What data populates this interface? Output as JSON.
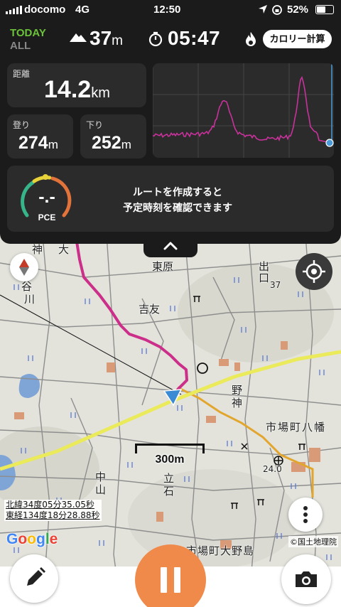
{
  "status_bar": {
    "carrier": "docomo",
    "network": "4G",
    "time": "12:50",
    "battery": "52%",
    "battery_level": 0.52
  },
  "header": {
    "today_label": "TODAY",
    "all_label": "ALL",
    "altitude_value": "37",
    "altitude_unit": "m",
    "elapsed_time": "05:47",
    "calorie_button": "カロリー計算"
  },
  "stats": {
    "distance_label": "距離",
    "distance_value": "14.2",
    "distance_unit": "km",
    "ascent_label": "登り",
    "ascent_value": "274",
    "ascent_unit": "m",
    "descent_label": "下り",
    "descent_value": "252",
    "descent_unit": "m"
  },
  "pace": {
    "value": "-.-",
    "label": "PCE",
    "message_line1": "ルートを作成すると",
    "message_line2": "予定時刻を確認できます"
  },
  "elevation_chart": {
    "line_color": "#c8329b",
    "cursor_color": "#4a9ad8"
  },
  "map": {
    "labels": {
      "tohara": "東原",
      "yoshitomo": "吉友",
      "tani": "谷",
      "kawa": "川",
      "ide": "出",
      "kuchi": "口",
      "no": "野",
      "kami": "神",
      "ichibacho_hachiman": "市場町八幡",
      "naka": "中",
      "yama": "山",
      "tate": "立",
      "ishi": "石",
      "ichibacho_ono": "市場町大野島",
      "alt_24": "24.0",
      "alt_37": "37",
      "tsukasa": "神",
      "oh": "大"
    },
    "scale": "300m",
    "latitude": "北緯34度05分35.05秒",
    "longitude": "東経134度18分28.88秒",
    "google_logo": "Google",
    "attribution": "©国土地理院",
    "track_color": "#cc2f8a"
  },
  "icons": {
    "compass": "compass-icon",
    "locate": "locate-icon",
    "more": "more-vertical-icon",
    "edit": "pencil-icon",
    "camera": "camera-icon",
    "pause": "pause-icon"
  }
}
